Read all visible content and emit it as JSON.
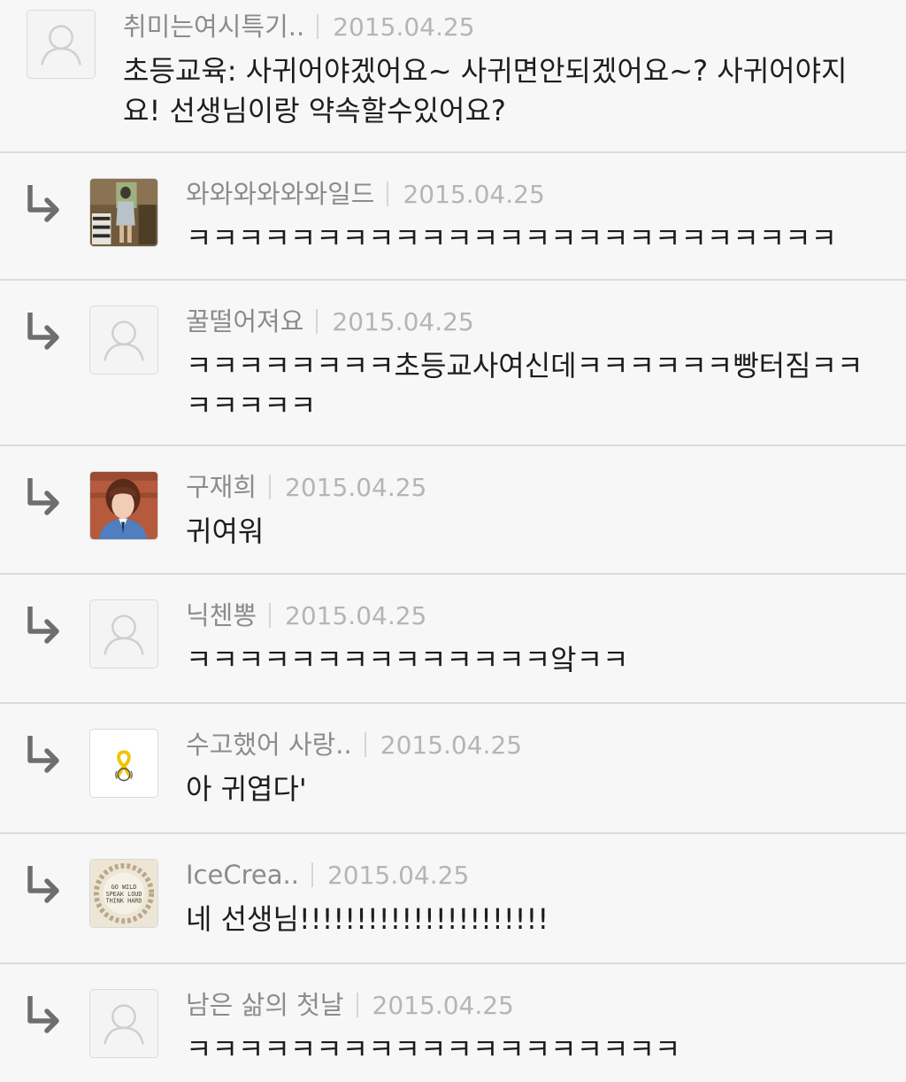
{
  "comments": [
    {
      "author": "취미는여시특기..",
      "date": "2015.04.25",
      "text": "초등교육: 사귀어야겠어요~ 사귀면안되겠어요~? 사귀어야지\n요! 선생님이랑 약속할수있어요?",
      "avatar": "default",
      "reply": false
    },
    {
      "author": "와와와와와와일드",
      "date": "2015.04.25",
      "text": "ㅋㅋㅋㅋㅋㅋㅋㅋㅋㅋㅋㅋㅋㅋㅋㅋㅋㅋㅋㅋㅋㅋㅋㅋㅋ",
      "avatar": "photo-person-standing",
      "reply": true
    },
    {
      "author": "꿀떨어져요",
      "date": "2015.04.25",
      "text": "ㅋㅋㅋㅋㅋㅋㅋㅋ초등교사여신데ㅋㅋㅋㅋㅋㅋ빵터짐ㅋㅋ\nㅋㅋㅋㅋㅋ",
      "avatar": "default",
      "reply": true
    },
    {
      "author": "구재희",
      "date": "2015.04.25",
      "text": "귀여워",
      "avatar": "photo-boy-portrait",
      "reply": true
    },
    {
      "author": "닉첸뽕",
      "date": "2015.04.25",
      "text": "ㅋㅋㅋㅋㅋㅋㅋㅋㅋㅋㅋㅋㅋㅋ앜ㅋㅋ",
      "avatar": "default",
      "reply": true
    },
    {
      "author": "수고했어 사랑..",
      "date": "2015.04.25",
      "text": "아 귀엽다'",
      "avatar": "yellow-ribbon",
      "reply": true
    },
    {
      "author": "IceCrea..",
      "date": "2015.04.25",
      "text": "네 선생님!!!!!!!!!!!!!!!!!!!!!!",
      "avatar": "wreath-badge",
      "reply": true
    },
    {
      "author": "남은 삶의 첫날",
      "date": "2015.04.25",
      "text": "ㅋㅋㅋㅋㅋㅋㅋㅋㅋㅋㅋㅋㅋㅋㅋㅋㅋㅋㅋ",
      "avatar": "default",
      "reply": true
    }
  ],
  "wreath_badge_text": "GO WILD SPEAK LOUD THINK HARD",
  "colors": {
    "background": "#f7f7f7",
    "author": "#8c8c8c",
    "date": "#b5b5b5",
    "body": "#1d1d1d",
    "arrow": "#6e6e6e",
    "divider": "#dcdcdc"
  }
}
